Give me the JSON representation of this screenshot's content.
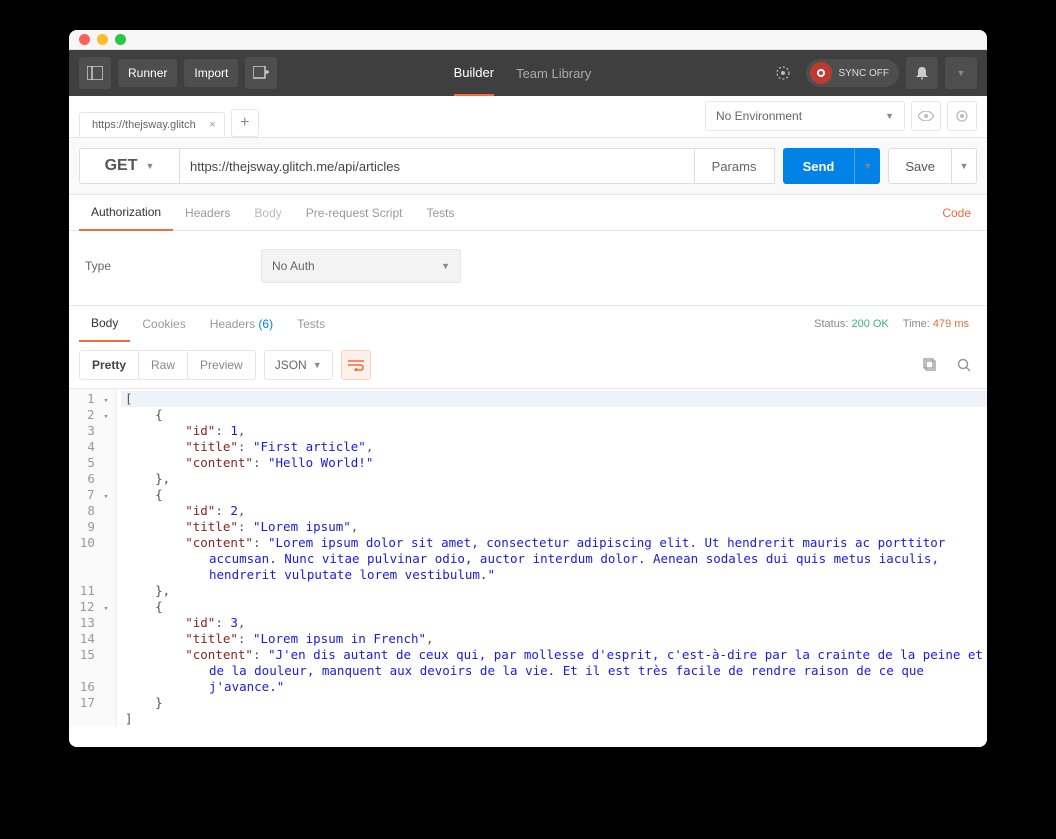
{
  "titlebar": {
    "dots": [
      "red",
      "yellow",
      "green"
    ]
  },
  "toolbar": {
    "runner_label": "Runner",
    "import_label": "Import",
    "nav": {
      "builder": "Builder",
      "team": "Team Library"
    },
    "sync_label": "SYNC OFF"
  },
  "tabs": {
    "tab0": "https://thejsway.glitch",
    "add": "+"
  },
  "env": {
    "label": "No Environment"
  },
  "request": {
    "method": "GET",
    "url": "https://thejsway.glitch.me/api/articles",
    "params_label": "Params",
    "send_label": "Send",
    "save_label": "Save"
  },
  "reqtabs": {
    "authorization": "Authorization",
    "headers": "Headers",
    "body": "Body",
    "prescript": "Pre-request Script",
    "tests": "Tests",
    "code": "Code"
  },
  "auth": {
    "type_label": "Type",
    "value": "No Auth"
  },
  "resptabs": {
    "body": "Body",
    "cookies": "Cookies",
    "headers": "Headers",
    "headers_count": "(6)",
    "tests": "Tests",
    "status_label": "Status:",
    "status_value": "200 OK",
    "time_label": "Time:",
    "time_value": "479 ms"
  },
  "viewmodes": {
    "pretty": "Pretty",
    "raw": "Raw",
    "preview": "Preview",
    "format": "JSON"
  },
  "code_lines": {
    "l1": "[",
    "l2": "    {",
    "l3_key": "        \"id\"",
    "l3_val": "1",
    "l4_key": "        \"title\"",
    "l4_val": "\"First article\"",
    "l5_key": "        \"content\"",
    "l5_val": "\"Hello World!\"",
    "l6": "    },",
    "l7": "    {",
    "l8_key": "        \"id\"",
    "l8_val": "2",
    "l9_key": "        \"title\"",
    "l9_val": "\"Lorem ipsum\"",
    "l10_key": "        \"content\"",
    "l10_val": "\"Lorem ipsum dolor sit amet, consectetur adipiscing elit. Ut hendrerit mauris ac porttitor accumsan. Nunc vitae pulvinar odio, auctor interdum dolor. Aenean sodales dui quis metus iaculis, hendrerit vulputate lorem vestibulum.\"",
    "l11": "    },",
    "l12": "    {",
    "l13_key": "        \"id\"",
    "l13_val": "3",
    "l14_key": "        \"title\"",
    "l14_val": "\"Lorem ipsum in French\"",
    "l15_key": "        \"content\"",
    "l15_val": "\"J'en dis autant de ceux qui, par mollesse d'esprit, c'est-à-dire par la crainte de la peine et de la douleur, manquent aux devoirs de la vie. Et il est très facile de rendre raison de ce que j'avance.\"",
    "l16": "    }",
    "l17": "]"
  }
}
